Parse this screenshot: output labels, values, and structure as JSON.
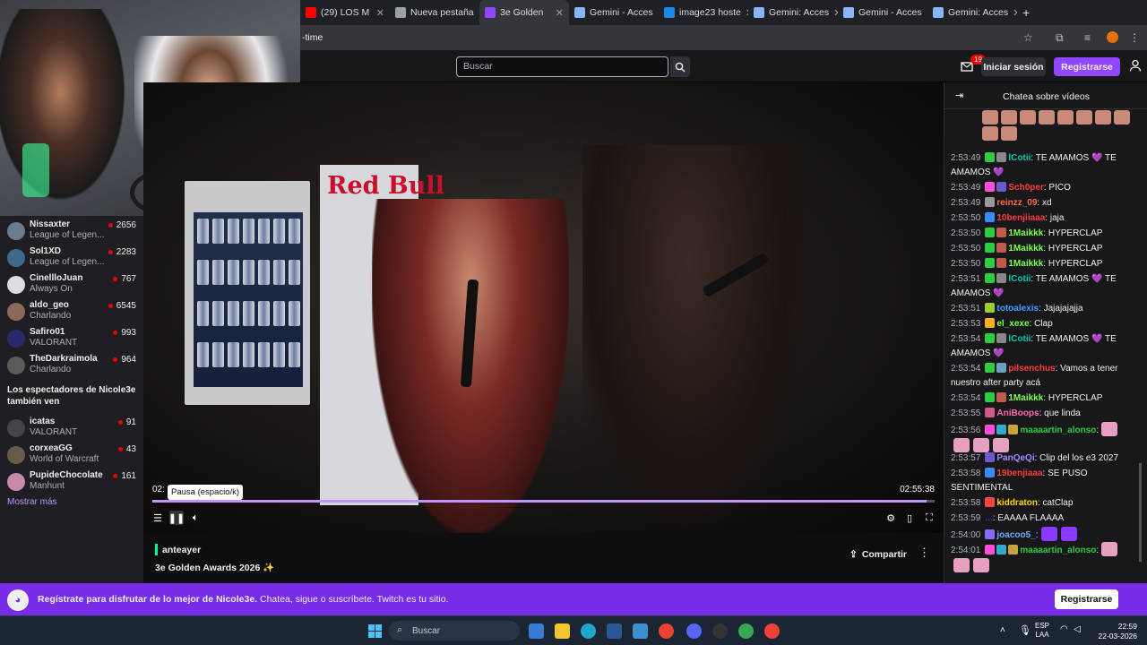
{
  "browser": {
    "tabs": [
      {
        "label": "(29) LOS M",
        "icon": "youtube-icon",
        "color": "#ff0000"
      },
      {
        "label": "Nueva pestaña",
        "icon": "chrome-icon",
        "color": "#9aa0a6"
      },
      {
        "label": "3e Golden",
        "icon": "twitch-icon",
        "color": "#9147ff",
        "active": true
      },
      {
        "label": "Gemini - Acces",
        "icon": "gemini-icon",
        "color": "#8ab4f8"
      },
      {
        "label": "image23 hoste",
        "icon": "imgbb-icon",
        "color": "#1e88e5"
      },
      {
        "label": "Gemini: Acces",
        "icon": "gemini-icon",
        "color": "#8ab4f8"
      },
      {
        "label": "Gemini - Acces",
        "icon": "gemini-icon",
        "color": "#8ab4f8"
      },
      {
        "label": "Gemini: Acces",
        "icon": "gemini-icon",
        "color": "#8ab4f8"
      }
    ],
    "address_text": "-time"
  },
  "topnav": {
    "search_placeholder": "Buscar",
    "notif_count": "19",
    "login": "Iniciar sesión",
    "register": "Registrarse"
  },
  "sidebar": {
    "channels": [
      {
        "name": "Nissaxter",
        "game": "League of Legen...",
        "viewers": "2656",
        "color": "#6a7b8c"
      },
      {
        "name": "Sol1XD",
        "game": "League of Legen...",
        "viewers": "2283",
        "color": "#3d6a8a"
      },
      {
        "name": "CinellloJuan",
        "game": "Always On",
        "viewers": "767",
        "color": "#ddd"
      },
      {
        "name": "aldo_geo",
        "game": "Charlando",
        "viewers": "6545",
        "color": "#8a6a5a"
      },
      {
        "name": "Safiro01",
        "game": "VALORANT",
        "viewers": "993",
        "color": "#2a2a6a"
      },
      {
        "name": "TheDarkraimola",
        "game": "Charlando",
        "viewers": "964",
        "color": "#5a5a5a"
      }
    ],
    "also_watch": "Los espectadores de Nicole3e también ven",
    "also_channels": [
      {
        "name": "icatas",
        "game": "VALORANT",
        "viewers": "91",
        "color": "#444"
      },
      {
        "name": "corxeaGG",
        "game": "World of Warcraft",
        "viewers": "43",
        "color": "#6a5a4a"
      },
      {
        "name": "PupideChocolate",
        "game": "Manhunt",
        "viewers": "161",
        "color": "#c58aa8"
      }
    ],
    "show_more": "Mostrar más"
  },
  "player": {
    "time_current": "02:",
    "time_total": "02:55:38",
    "tooltip": "Pausa (espacio/k)",
    "progress": 0.99,
    "brand_sign": "Red Bull"
  },
  "video_info": {
    "author": "anteayer",
    "title": "3e Golden Awards 2026 ✨",
    "share": "Compartir"
  },
  "chat": {
    "header": "Chatea sobre vídeos",
    "messages": [
      {
        "ts": "2:53:49",
        "user": "lCotii",
        "ucolor": "#00c8af",
        "text": ": TE AMAMOS 💜 TE AMAMOS 💜",
        "badges": [
          "#2ecc40",
          "#888"
        ],
        "lines": 2
      },
      {
        "ts": "2:53:49",
        "user": "Sch0per",
        "ucolor": "#ff3b3b",
        "text": ": PICO",
        "badges": [
          "#ff4fd8",
          "#6a5acd"
        ],
        "lines": 1
      },
      {
        "ts": "2:53:49",
        "user": "reinzz_09",
        "ucolor": "#ff6a3d",
        "text": ": xd",
        "badges": [
          "#999"
        ],
        "lines": 1
      },
      {
        "ts": "2:53:50",
        "user": "10benjiiaaa",
        "ucolor": "#ff3b3b",
        "text": ": jaja",
        "badges": [
          "#3a8bff"
        ],
        "lines": 1
      },
      {
        "ts": "2:53:50",
        "user": "1Maikkk",
        "ucolor": "#7cff4d",
        "text": ": HYPERCLAP",
        "badges": [
          "#2ecc40",
          "#c05a4a"
        ],
        "lines": 1
      },
      {
        "ts": "2:53:50",
        "user": "1Maikkk",
        "ucolor": "#7cff4d",
        "text": ": HYPERCLAP",
        "badges": [
          "#2ecc40",
          "#c05a4a"
        ],
        "lines": 1
      },
      {
        "ts": "2:53:50",
        "user": "1Maikkk",
        "ucolor": "#7cff4d",
        "text": ": HYPERCLAP",
        "badges": [
          "#2ecc40",
          "#c05a4a"
        ],
        "lines": 1
      },
      {
        "ts": "2:53:51",
        "user": "lCotii",
        "ucolor": "#00c8af",
        "text": ": TE AMAMOS 💜 TE AMAMOS 💜",
        "badges": [
          "#2ecc40",
          "#888"
        ],
        "lines": 2
      },
      {
        "ts": "2:53:51",
        "user": "totoalexis",
        "ucolor": "#3da0ff",
        "text": ": Jajajajajja",
        "badges": [
          "#9acd32"
        ],
        "lines": 1
      },
      {
        "ts": "2:53:53",
        "user": "el_xexe",
        "ucolor": "#7cff4d",
        "text": ": Clap",
        "badges": [
          "#ffb020"
        ],
        "lines": 1
      },
      {
        "ts": "2:53:54",
        "user": "lCotii",
        "ucolor": "#00c8af",
        "text": ": TE AMAMOS 💜 TE AMAMOS 💜",
        "badges": [
          "#2ecc40",
          "#888"
        ],
        "lines": 2
      },
      {
        "ts": "2:53:54",
        "user": "pilsenchus",
        "ucolor": "#ff3b3b",
        "text": ": Vamos a tener nuestro after party acá",
        "badges": [
          "#2ecc40",
          "#6aa0c0"
        ],
        "lines": 2
      },
      {
        "ts": "2:53:54",
        "user": "1Maikkk",
        "ucolor": "#7cff4d",
        "text": ": HYPERCLAP",
        "badges": [
          "#2ecc40",
          "#c05a4a"
        ],
        "lines": 1
      },
      {
        "ts": "2:53:55",
        "user": "AniBoops",
        "ucolor": "#ff69b4",
        "text": ": que linda",
        "badges": [
          "#d05a8a"
        ],
        "lines": 1
      },
      {
        "ts": "2:53:56",
        "user": "maaaartin_alonso",
        "ucolor": "#2ecc40",
        "text": ":",
        "badges": [
          "#ff4fd8",
          "#3ac",
          "#c8a040"
        ],
        "lines": 2,
        "emotes": 4
      },
      {
        "ts": "2:53:57",
        "user": "PanQeQi",
        "ucolor": "#a58aff",
        "text": ": Clip del los e3 2027",
        "badges": [
          "#6a5acd"
        ],
        "lines": 1
      },
      {
        "ts": "2:53:58",
        "user": "19benjiaaa",
        "ucolor": "#ff3b3b",
        "text": ": SE PUSO SENTIMENTAL",
        "badges": [
          "#3a8bff"
        ],
        "lines": 2
      },
      {
        "ts": "2:53:58",
        "user": "kiddraton",
        "ucolor": "#ffd700",
        "text": ": catClap",
        "badges": [
          "#ff4444"
        ],
        "lines": 1
      },
      {
        "ts": "2:53:59",
        "user": "...",
        "ucolor": "#2b2bff",
        "text": ": EAAAA FLAAAA",
        "badges": [],
        "lines": 1
      },
      {
        "ts": "2:54:00",
        "user": "joacoo5_",
        "ucolor": "#6ab0ff",
        "text": ":",
        "badges": [
          "#8a6aff"
        ],
        "lines": 1,
        "emotes": 2
      },
      {
        "ts": "2:54:01",
        "user": "maaaartin_alonso",
        "ucolor": "#2ecc40",
        "text": ":",
        "badges": [
          "#ff4fd8",
          "#3ac",
          "#c8a040"
        ],
        "lines": 2,
        "emotes": 3
      }
    ]
  },
  "banner": {
    "text_bold": "Regístrate para disfrutar de lo mejor de Nicole3e.",
    "text_rest": " Chatea, sigue o suscríbete. Twitch es tu sitio.",
    "button": "Registrarse"
  },
  "taskbar": {
    "search": "Buscar",
    "lang1": "ESP",
    "lang2": "LAA",
    "time": "22:59",
    "date": "22-03-2026"
  }
}
